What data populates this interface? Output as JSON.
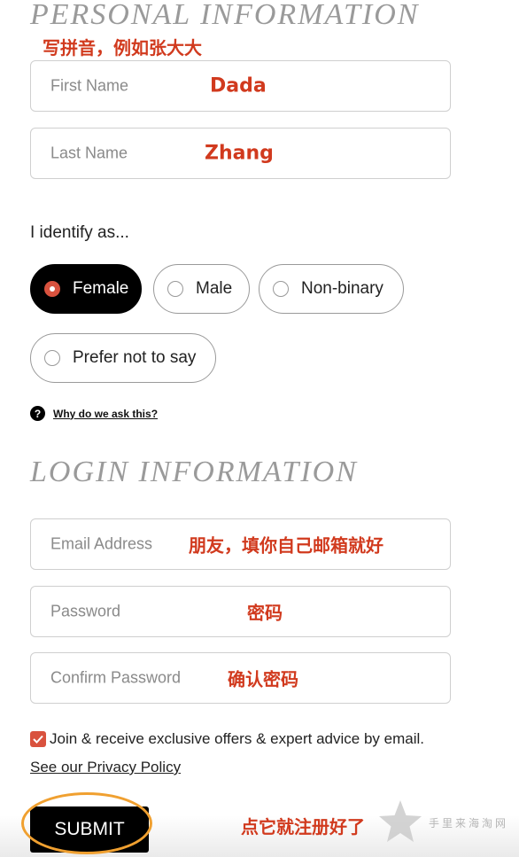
{
  "personal": {
    "title": "PERSONAL INFORMATION",
    "note": "写拼音，例如张大大",
    "first_name": {
      "placeholder": "First Name",
      "annotation": "Dada"
    },
    "last_name": {
      "placeholder": "Last Name",
      "annotation": "Zhang"
    }
  },
  "identify": {
    "label": "I identify as...",
    "options": [
      {
        "label": "Female",
        "selected": true
      },
      {
        "label": "Male",
        "selected": false
      },
      {
        "label": "Non-binary",
        "selected": false
      },
      {
        "label": "Prefer not to say",
        "selected": false
      }
    ],
    "help_icon": "?",
    "help_text": "Why do we ask this?"
  },
  "login": {
    "title": "LOGIN INFORMATION",
    "email": {
      "placeholder": "Email Address",
      "annotation": "朋友，填你自己邮箱就好"
    },
    "password": {
      "placeholder": "Password",
      "annotation": "密码"
    },
    "confirm": {
      "placeholder": "Confirm Password",
      "annotation": "确认密码"
    }
  },
  "newsletter": {
    "checked": true,
    "text": "Join & receive exclusive offers & expert advice by email."
  },
  "privacy_link": "See our Privacy Policy",
  "submit": {
    "label": "SUBMIT",
    "annotation": "点它就注册好了"
  },
  "watermark": "手里来海淘网",
  "colors": {
    "annotation_red": "#d13a1e",
    "accent": "#d9523e",
    "highlight_ring": "#f0a030",
    "heading_gray": "#9a9a9a"
  }
}
